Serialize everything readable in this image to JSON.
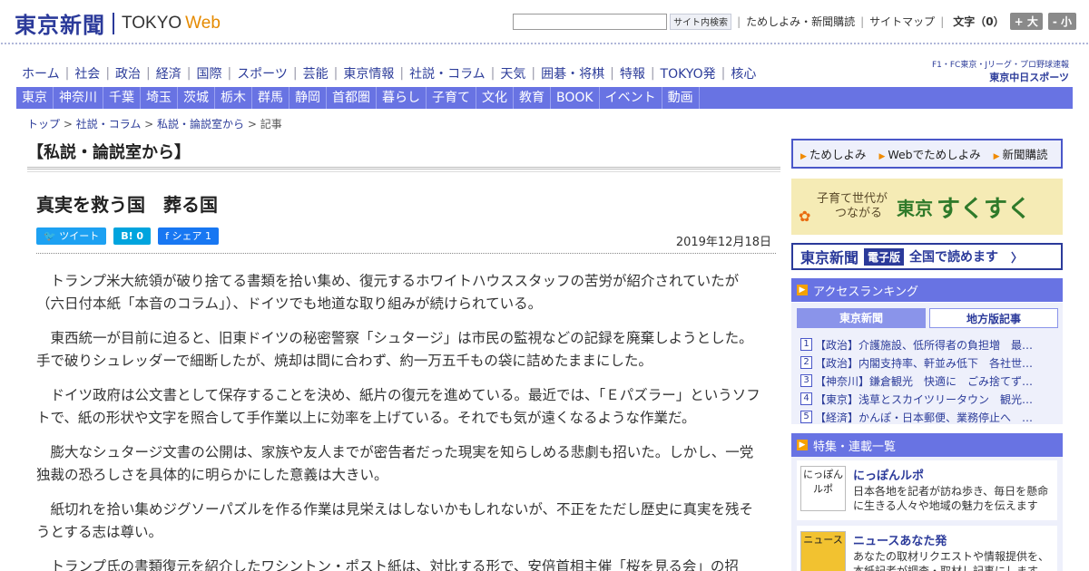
{
  "header": {
    "logo_ja": "東京新聞",
    "logo_en1": "TOKYO",
    "logo_en2": "Web",
    "search_button": "サイト内検索",
    "links": [
      "ためしよみ・新聞購読",
      "サイトマップ"
    ],
    "font_size_label": "文字（0）",
    "font_plus": "+ 大",
    "font_minus": "- 小"
  },
  "global_nav": [
    "ホーム",
    "社会",
    "政治",
    "経済",
    "国際",
    "スポーツ",
    "芸能",
    "東京情報",
    "社説・コラム",
    "天気",
    "囲碁・将棋",
    "特報",
    "TOKYO発",
    "核心"
  ],
  "chunichi": {
    "line1": "F1・FC東京・Jリーグ・プロ野球速報",
    "line2": "東京中日スポーツ"
  },
  "region_nav": [
    "東京",
    "神奈川",
    "千葉",
    "埼玉",
    "茨城",
    "栃木",
    "群馬",
    "静岡",
    "首都圏",
    "暮らし",
    "子育て",
    "文化",
    "教育",
    "BOOK",
    "イベント",
    "動画"
  ],
  "breadcrumb": {
    "items": [
      "トップ",
      "社説・コラム",
      "私説・論説室から"
    ],
    "current": "記事"
  },
  "article": {
    "section": "【私説・論説室から】",
    "title": "真実を救う国　葬る国",
    "date": "2019年12月18日",
    "share": {
      "tweet": "ツイート",
      "hatena": "B! 0",
      "facebook": "シェア 1"
    },
    "paragraphs": [
      "トランプ米大統領が破り捨てる書類を拾い集め、復元するホワイトハウススタッフの苦労が紹介されていたが（六日付本紙「本音のコラム」）、ドイツでも地道な取り組みが続けられている。",
      "東西統一が目前に迫ると、旧東ドイツの秘密警察「シュタージ」は市民の監視などの記録を廃棄しようとした。手で破りシュレッダーで細断したが、焼却は間に合わず、約一万五千もの袋に詰めたままにした。",
      "ドイツ政府は公文書として保存することを決め、紙片の復元を進めている。最近では、「Ｅパズラー」というソフトで、紙の形状や文字を照合して手作業以上に効率を上げている。それでも気が遠くなるような作業だ。",
      "膨大なシュタージ文書の公開は、家族や友人までが密告者だった現実を知らしめる悲劇も招いた。しかし、一党独裁の恐ろしさを具体的に明らかにした意義は大きい。",
      "紙切れを拾い集めジグソーパズルを作る作業は見栄えはしないかもしれないが、不正をただし歴史に真実を残そうとする志は尊い。",
      "トランプ氏の書類復元を紹介したワシントン・ポスト紙は、対比する形で、安倍首相主催「桜を見る会」の招"
    ]
  },
  "sidebar": {
    "quick_links": [
      "ためしよみ",
      "Webでためしよみ",
      "新聞購読"
    ],
    "sukusuku": {
      "line1": "子育て世代が",
      "line2": "つながる",
      "brand1": "東京",
      "brand2": "すくすく"
    },
    "denshi": {
      "logo": "東京新聞",
      "badge": "電子版",
      "text": "全国で読めます"
    },
    "ranking": {
      "heading": "アクセスランキング",
      "tabs": [
        "東京新聞",
        "地方版記事"
      ],
      "items": [
        "【政治】介護施設、低所得者の負担増　最…",
        "【政治】内閣支持率、軒並み低下　各社世…",
        "【神奈川】鎌倉観光　快適に　ごみ捨てず…",
        "【東京】浅草とスカイツリータウン　観光…",
        "【経済】かんぽ・日本郵便、業務停止へ　…"
      ]
    },
    "features": {
      "heading": "特集・連載一覧",
      "items": [
        {
          "title": "にっぽんルポ",
          "desc": "日本各地を記者が訪ね歩き、毎日を懸命に生きる人々や地域の魅力を伝えます",
          "thumb": "にっぽんルポ"
        },
        {
          "title": "ニュースあなた発",
          "desc": "あなたの取材リクエストや情報提供を、本紙記者が調査・取材し記事にします",
          "thumb": "ニュース"
        }
      ]
    }
  },
  "colors": {
    "brand_blue": "#2b3a9a",
    "nav_blue": "#6873e3",
    "accent_orange": "#f5a100"
  }
}
